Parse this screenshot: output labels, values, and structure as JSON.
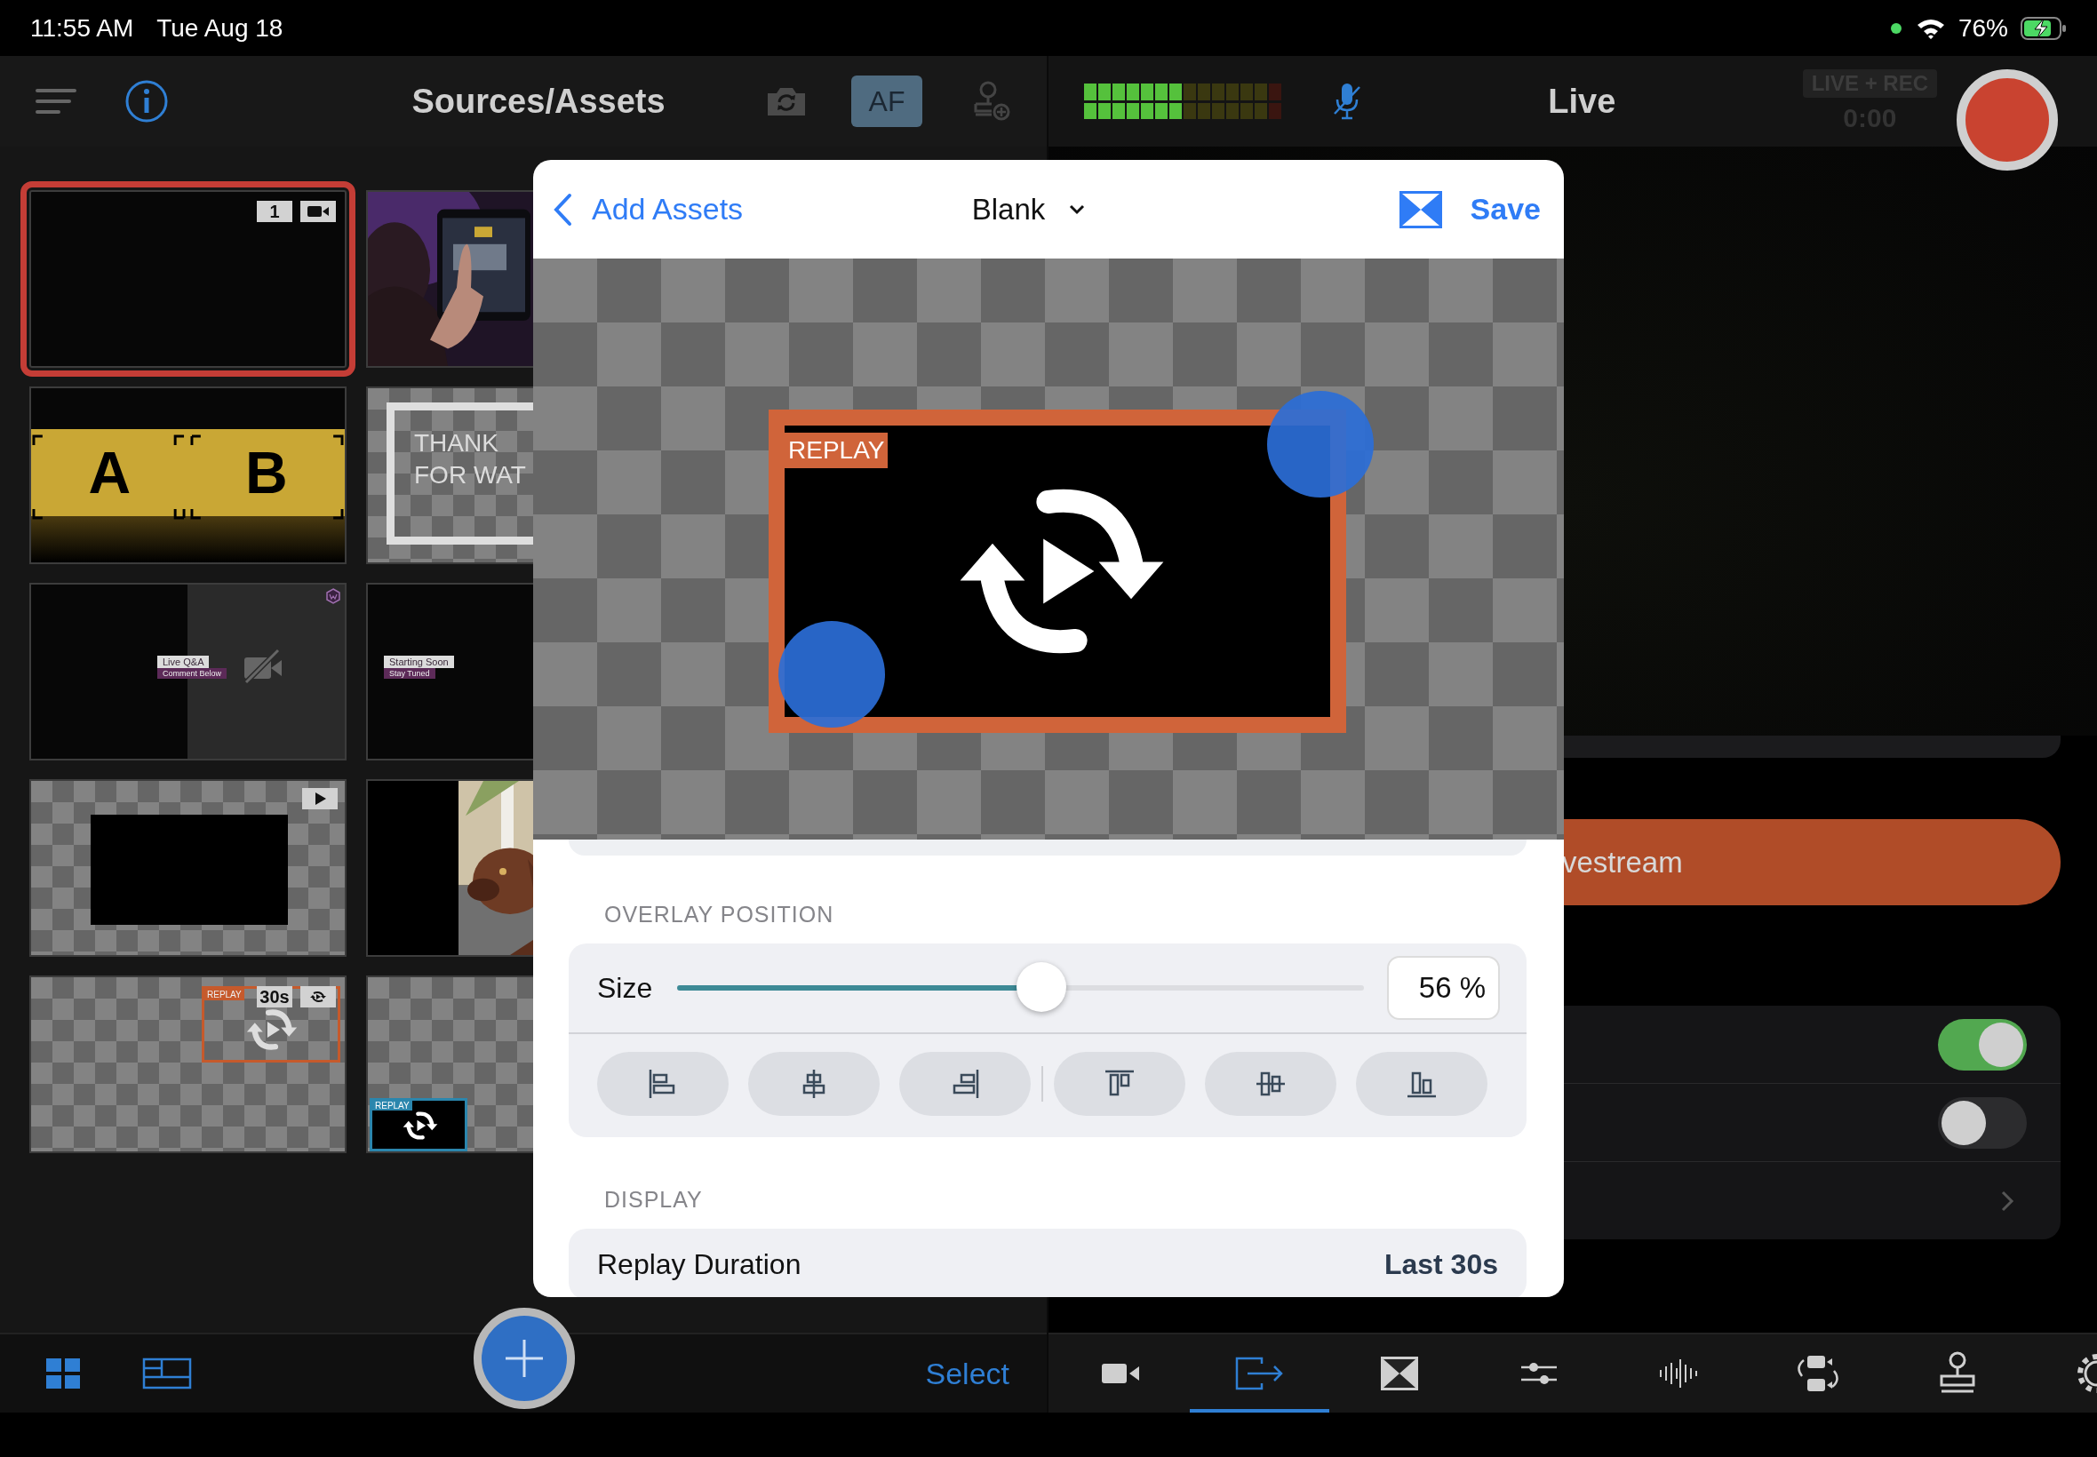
{
  "status_bar": {
    "time": "11:55 AM",
    "date": "Tue Aug 18",
    "battery": "76%"
  },
  "sources_toolbar": {
    "title": "Sources/Assets",
    "focus_button": "AF"
  },
  "live_toolbar": {
    "title": "Live",
    "meter": {
      "level": 0.5
    },
    "mode_badge": "LIVE + REC",
    "timer": "0:00"
  },
  "thumbnails": [
    {
      "kind": "camera",
      "selected": true,
      "badge": "1"
    },
    {
      "kind": "picture",
      "selected": false
    },
    {
      "kind": "ab",
      "selected": false,
      "left": "A",
      "right": "B"
    },
    {
      "kind": "thanks",
      "selected": false,
      "lines": [
        "THANK",
        "FOR WAT"
      ]
    },
    {
      "kind": "lower-third-split",
      "selected": false,
      "title": "Live Q&A",
      "subtitle": "Comment Below"
    },
    {
      "kind": "lower-third",
      "selected": false,
      "title": "Starting Soon",
      "subtitle": "Stay Tuned"
    },
    {
      "kind": "video",
      "selected": false
    },
    {
      "kind": "picture",
      "selected": false
    },
    {
      "kind": "replay",
      "selected": false,
      "tag": "REPLAY",
      "badge": "30s"
    },
    {
      "kind": "replay-mini",
      "selected": false,
      "tag": "REPLAY"
    }
  ],
  "sources_bottom_bar": {
    "select_label": "Select"
  },
  "editor": {
    "back_label": "Add Assets",
    "layer": "Blank",
    "save_label": "Save",
    "preview_tag": "REPLAY",
    "overlay_position": {
      "header": "OVERLAY POSITION",
      "size_label": "Size",
      "size": {
        "level": 0.53
      },
      "size_value": "56 %"
    },
    "display": {
      "header": "DISPLAY",
      "rows": [
        {
          "label": "Replay Duration",
          "value": "Last 30s"
        }
      ]
    }
  },
  "live_panel": {
    "stream_button": "vestream",
    "toggles": [
      {
        "on": true
      },
      {
        "on": false
      }
    ]
  },
  "live_bottom_bar": {
    "tabs": [
      {
        "selected": false
      },
      {
        "selected": true
      },
      {
        "selected": false
      },
      {
        "selected": false
      },
      {
        "selected": false
      },
      {
        "selected": false
      },
      {
        "selected": false
      },
      {
        "selected": false
      }
    ]
  }
}
